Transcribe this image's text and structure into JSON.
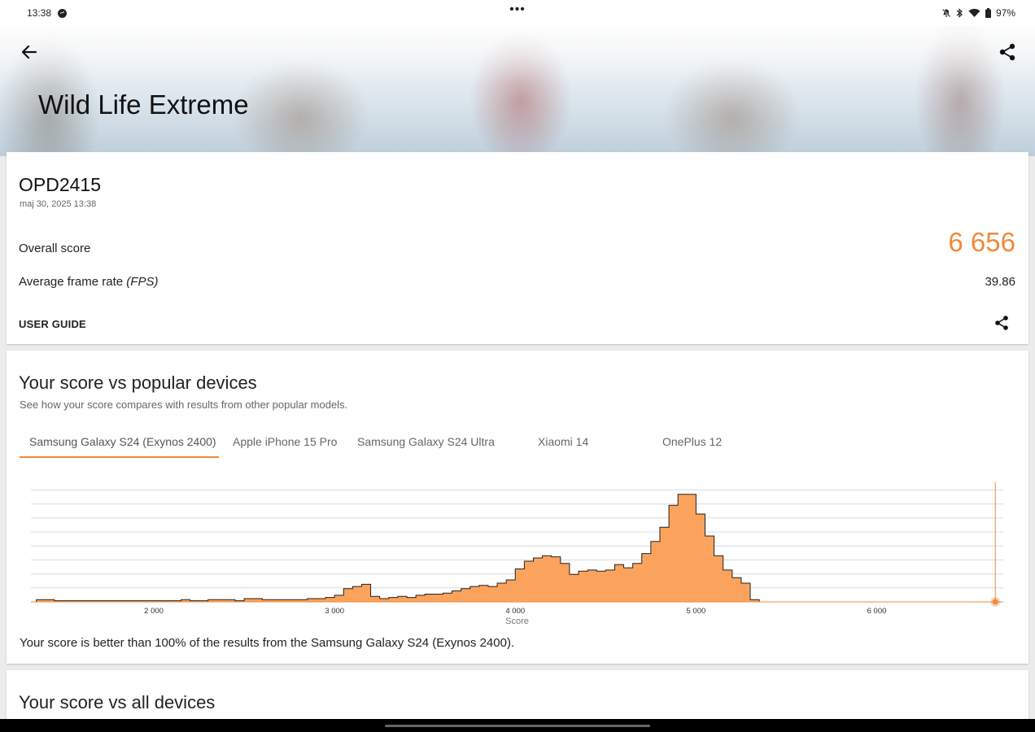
{
  "status_bar": {
    "time": "13:38",
    "battery": "97%",
    "center_dots": "•••"
  },
  "hero": {
    "title": "Wild Life Extreme"
  },
  "result": {
    "device_name": "OPD2415",
    "date": "maj 30, 2025 13:38",
    "overall_label": "Overall score",
    "overall_value": "6 656",
    "fps_label_main": "Average frame rate",
    "fps_label_unit": "(FPS)",
    "fps_value": "39.86",
    "user_guide": "USER GUIDE"
  },
  "compare": {
    "title": "Your score vs popular devices",
    "subtitle": "See how your score compares with results from other popular models.",
    "tabs": [
      "Samsung Galaxy S24 (Exynos 2400)",
      "Apple iPhone 15 Pro",
      "Samsung Galaxy S24 Ultra",
      "Xiaomi 14",
      "OnePlus 12"
    ],
    "active_tab": 0,
    "verdict": "Your score is better than 100% of the results from the Samsung Galaxy S24 (Exynos 2400)."
  },
  "all_devices": {
    "title": "Your score vs all devices"
  },
  "colors": {
    "accent": "#f08a3a",
    "histogram_fill": "#fba35c",
    "histogram_stroke": "#222222"
  },
  "chart_data": {
    "type": "area",
    "xlabel": "Score",
    "x_ticks": [
      2000,
      3000,
      4000,
      5000,
      6000
    ],
    "x_tick_labels": [
      "2 000",
      "3 000",
      "4 000",
      "5 000",
      "6 000"
    ],
    "xlim": [
      1320,
      6700
    ],
    "grid": true,
    "bin_width": 50,
    "bins_start": 1350,
    "distribution": [
      0.02,
      0.02,
      0.01,
      0.01,
      0.01,
      0.01,
      0.01,
      0.01,
      0.01,
      0.01,
      0.01,
      0.01,
      0.01,
      0.01,
      0.01,
      0.01,
      0.02,
      0.01,
      0.01,
      0.02,
      0.02,
      0.02,
      0.01,
      0.03,
      0.03,
      0.02,
      0.02,
      0.02,
      0.02,
      0.02,
      0.03,
      0.03,
      0.04,
      0.06,
      0.12,
      0.14,
      0.16,
      0.05,
      0.03,
      0.04,
      0.05,
      0.04,
      0.06,
      0.07,
      0.07,
      0.08,
      0.1,
      0.12,
      0.14,
      0.15,
      0.14,
      0.17,
      0.2,
      0.3,
      0.37,
      0.4,
      0.42,
      0.41,
      0.35,
      0.25,
      0.28,
      0.29,
      0.28,
      0.29,
      0.34,
      0.31,
      0.35,
      0.44,
      0.55,
      0.68,
      0.88,
      0.98,
      0.98,
      0.8,
      0.6,
      0.42,
      0.29,
      0.22,
      0.17,
      0.02
    ],
    "your_score": 6656
  }
}
